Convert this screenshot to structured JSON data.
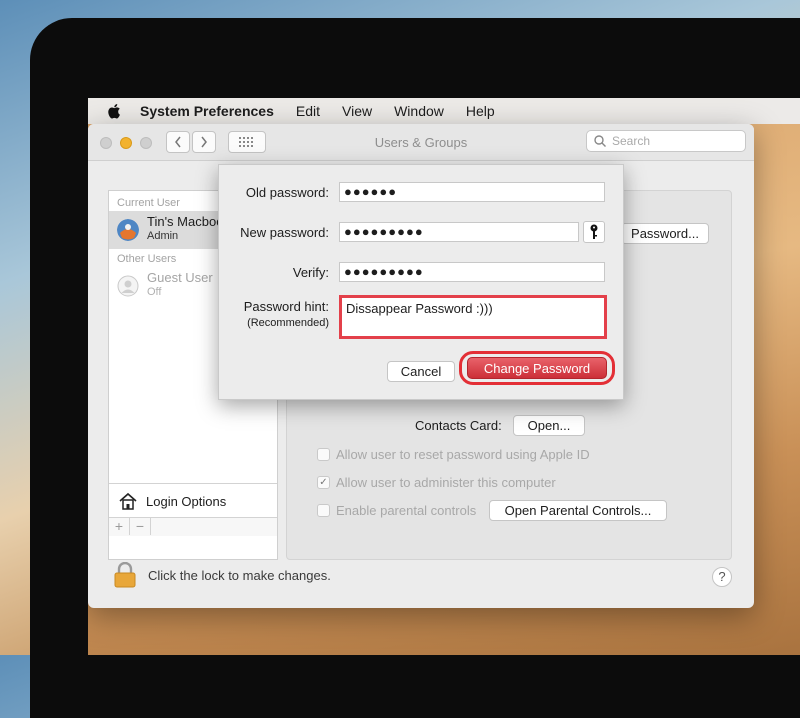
{
  "menubar": {
    "items": [
      "System Preferences",
      "Edit",
      "View",
      "Window",
      "Help"
    ]
  },
  "window": {
    "title": "Users & Groups",
    "search_placeholder": "Search"
  },
  "sidebar": {
    "current_user_header": "Current User",
    "current_user": {
      "name": "Tin's Macbook",
      "role": "Admin"
    },
    "other_users_header": "Other Users",
    "guest_user": {
      "name": "Guest User",
      "role": "Off"
    },
    "login_options": "Login Options",
    "add": "+",
    "remove": "−"
  },
  "panel": {
    "change_password_button": "Password...",
    "contacts_card_label": "Contacts Card:",
    "open_button": "Open...",
    "checkboxes": [
      {
        "label": "Allow user to reset password using Apple ID",
        "checked": false
      },
      {
        "label": "Allow user to administer this computer",
        "checked": true
      },
      {
        "label": "Enable parental controls",
        "checked": false
      }
    ],
    "parental_button": "Open Parental Controls..."
  },
  "footer": {
    "lock_text": "Click the lock to make changes.",
    "help": "?"
  },
  "dialog": {
    "old_password_label": "Old password:",
    "old_password_value": "●●●●●●",
    "new_password_label": "New password:",
    "new_password_value": "●●●●●●●●●",
    "verify_label": "Verify:",
    "verify_value": "●●●●●●●●●",
    "hint_label": "Password hint:",
    "hint_sublabel": "(Recommended)",
    "hint_value": "Dissappear Password :)))",
    "cancel": "Cancel",
    "change_password": "Change Password"
  },
  "colors": {
    "accent_red": "#e3404a",
    "primary_button": "#d7383f"
  }
}
